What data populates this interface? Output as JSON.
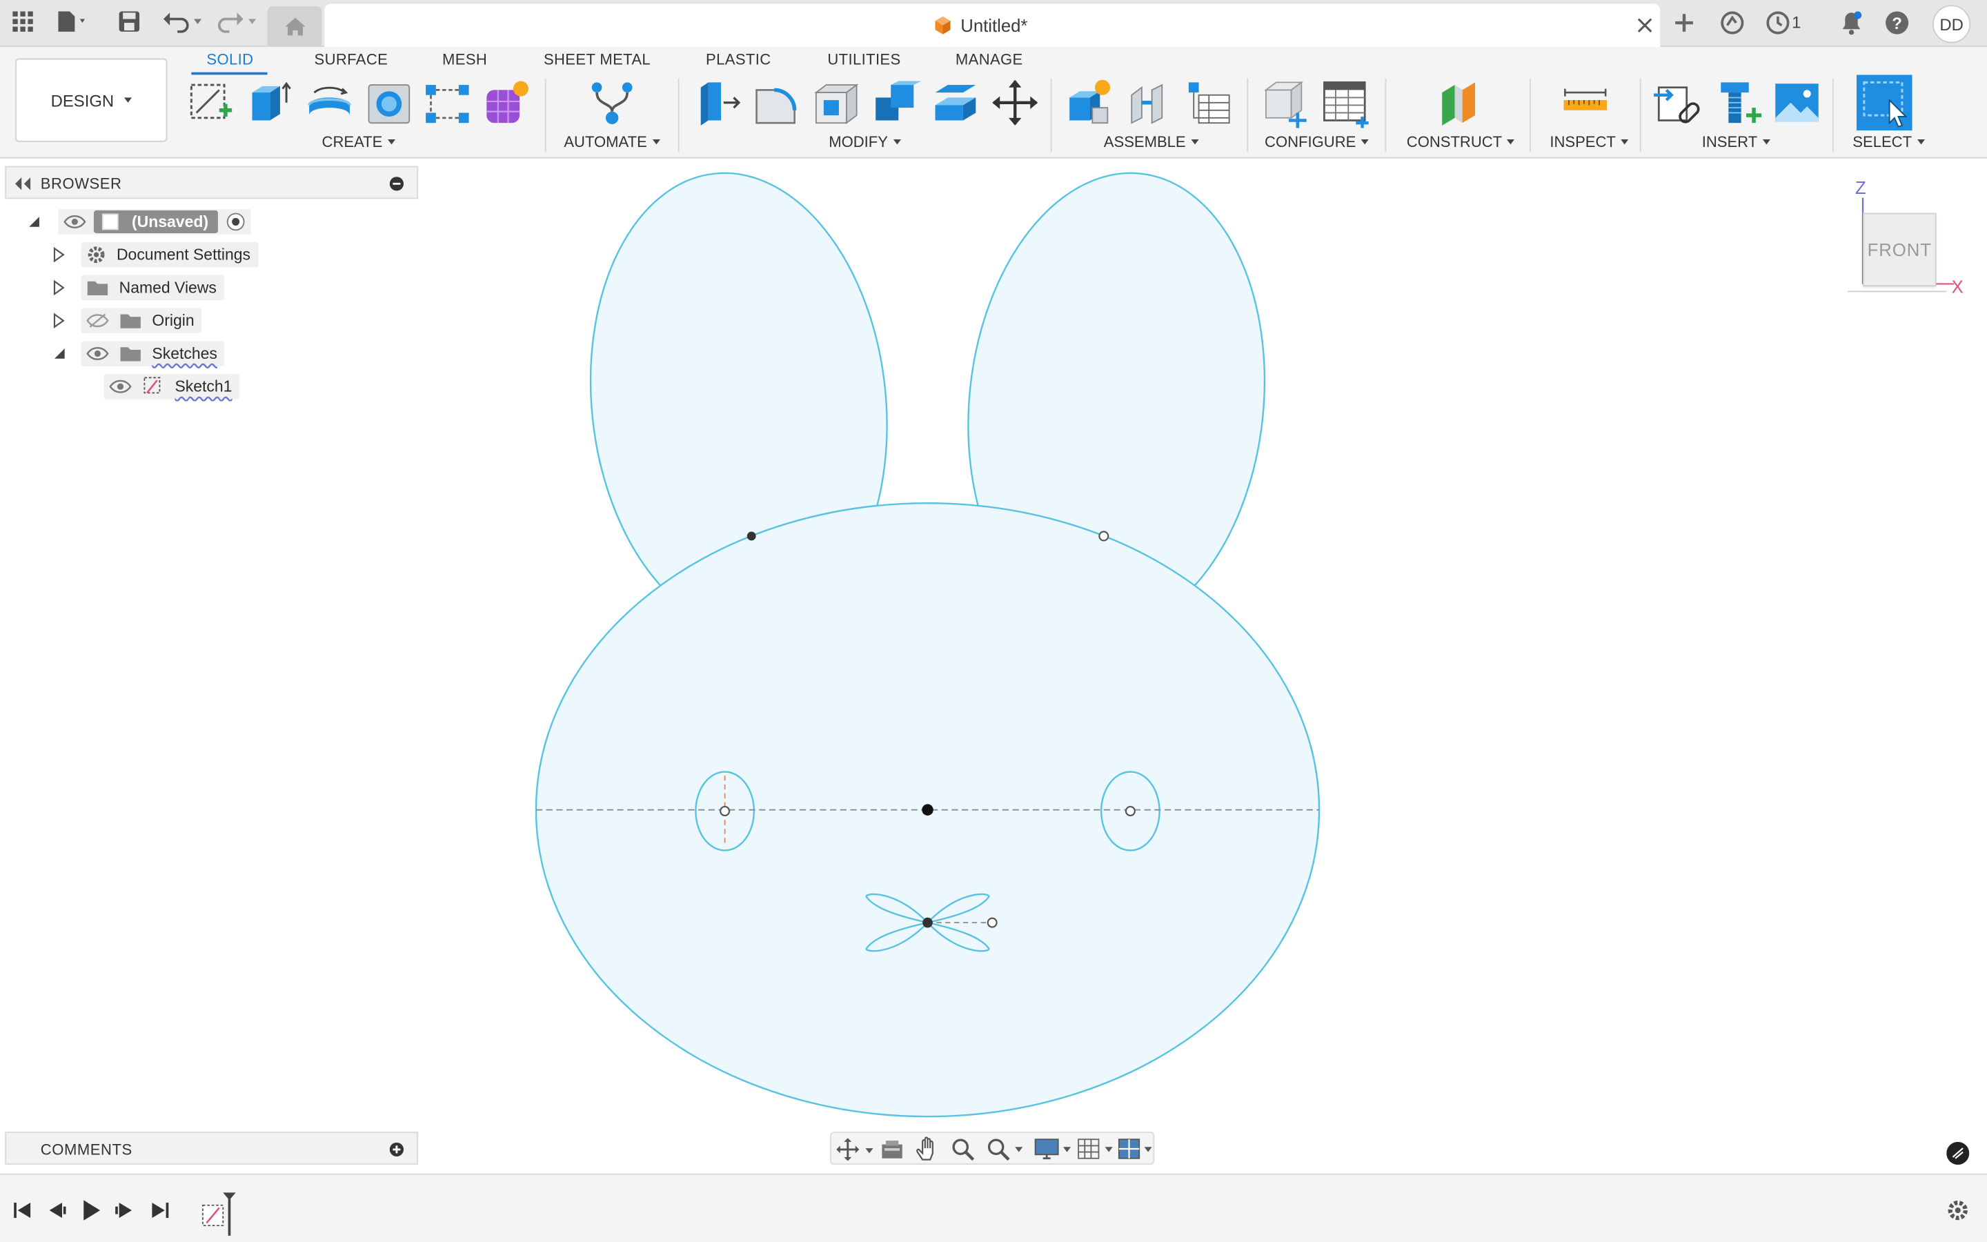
{
  "titlebar": {
    "document_title": "Untitled*",
    "job_count": "1",
    "user_initials": "DD"
  },
  "ribbon": {
    "workspace_label": "DESIGN",
    "tabs": [
      {
        "label": "SOLID",
        "active": true
      },
      {
        "label": "SURFACE"
      },
      {
        "label": "MESH"
      },
      {
        "label": "SHEET METAL"
      },
      {
        "label": "PLASTIC"
      },
      {
        "label": "UTILITIES"
      },
      {
        "label": "MANAGE"
      }
    ],
    "groups": {
      "create": "CREATE",
      "automate": "AUTOMATE",
      "modify": "MODIFY",
      "assemble": "ASSEMBLE",
      "configure": "CONFIGURE",
      "construct": "CONSTRUCT",
      "inspect": "INSPECT",
      "insert": "INSERT",
      "select": "SELECT"
    }
  },
  "browser": {
    "title": "BROWSER",
    "root": "(Unsaved)",
    "items": [
      {
        "label": "Document Settings"
      },
      {
        "label": "Named Views"
      },
      {
        "label": "Origin"
      },
      {
        "label": "Sketches"
      },
      {
        "label": "Sketch1"
      }
    ]
  },
  "viewcube": {
    "face": "FRONT",
    "axis_z": "Z",
    "axis_x": "X"
  },
  "comments": {
    "title": "COMMENTS"
  },
  "colors": {
    "accent": "#1a7bd3",
    "sketch_line": "#57c3e0",
    "sketch_fill": "#ecf8fd",
    "axis_z": "#6a70d8",
    "axis_x": "#e0507a"
  }
}
